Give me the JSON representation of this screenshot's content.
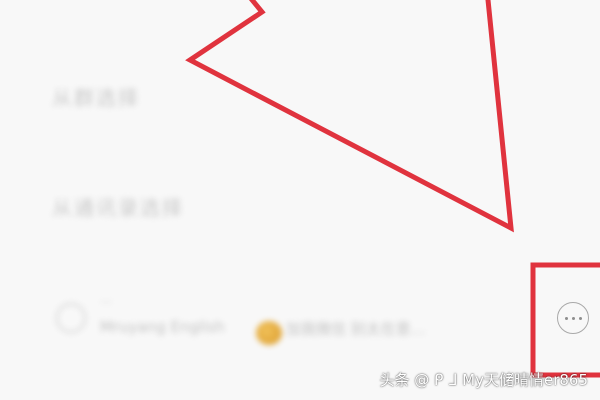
{
  "menu": {
    "top_partial": "",
    "item_1": "从群选择",
    "item_2": "从通讯录选择",
    "bottom_partial": ""
  },
  "chat_item": {
    "name": "...",
    "preview": "Mruyang English",
    "preview_tail": "加我微信 别太在意…"
  },
  "more_button": {
    "icon": "more-dots-icon"
  },
  "annotation": {
    "color": "#e0333e"
  },
  "watermark": {
    "text": "头条 @ ᑭ ᒧ My天储晴情er865"
  },
  "colors": {
    "background": "#f8f8f8",
    "annotation_red": "#e0333e",
    "muted_text": "#c9c9c9"
  }
}
